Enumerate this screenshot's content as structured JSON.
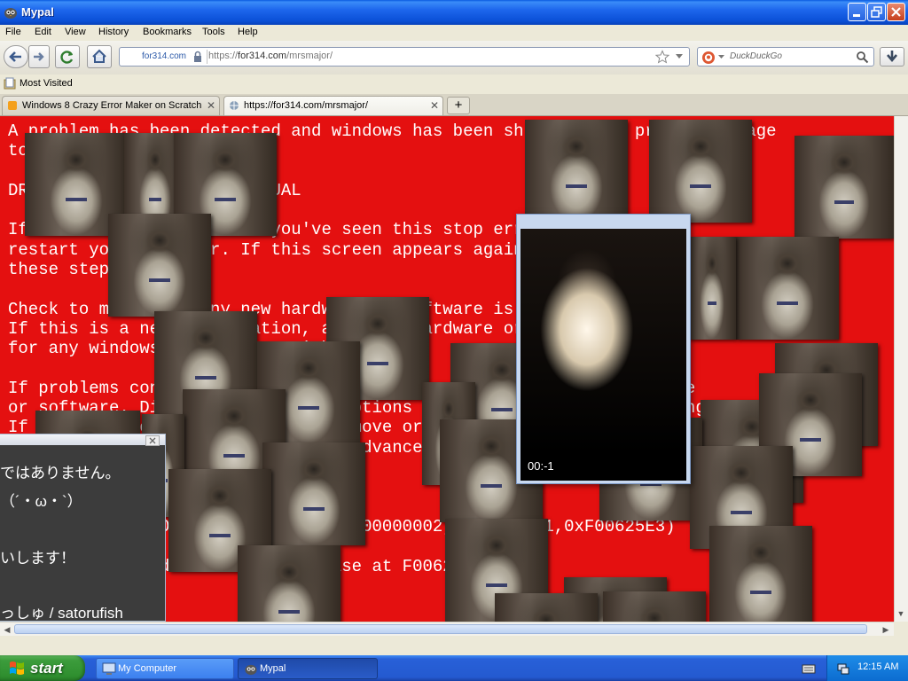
{
  "window": {
    "title": "Mypal"
  },
  "menu": [
    "File",
    "Edit",
    "View",
    "History",
    "Bookmarks",
    "Tools",
    "Help"
  ],
  "nav": {
    "identity": "for314.com",
    "url_prefix": "https://",
    "url_host": "for314.com",
    "url_path": "/mrsmajor/",
    "search_placeholder": "DuckDuckGo"
  },
  "bookmarks": {
    "most_visited": "Most Visited"
  },
  "tabs": [
    {
      "label": "Windows 8 Crazy Error Maker on Scratch"
    },
    {
      "label": "https://for314.com/mrsmajor/"
    }
  ],
  "bsod_lines": [
    "A problem has been detected and windows has been shut down to prevent damage",
    "to your computer.",
    "",
    "DRIVER_IRQL_NOT_LESS_OR_EQUAL",
    "",
    "If this is the first time you've seen this stop error screen,",
    "restart your computer. If this screen appears again, follow",
    "these steps:",
    "",
    "Check to make sure any new hardware or software is properly installed.",
    "If this is a new installation, ask your hardware or software manufacturer",
    "for any windows updates you might need.",
    "",
    "If problems continue, disable or remove any newly installed hardware",
    "or software. Disable BIOS memory options such as caching or shadowing.",
    "If you need to use Safe Mode to remove or disable components, restart",
    "your computer, press F8 to select Advanced Startup Options.",
    "",
    "",
    "",
    "*** STOP: 0x000000D1 (0x00000000,0x00000002,0x00000001,0xF00625E3)",
    "",
    "*** gv3.sys - Address F00625E3 base at F0062000"
  ],
  "video": {
    "time": "00:-1"
  },
  "jp_window": {
    "lines": [
      "ではありません。",
      "（´・ω・`）",
      "",
      "いします！",
      "",
      "っしゅ / satorufish"
    ]
  },
  "taskbar": {
    "start": "start",
    "tasks": [
      {
        "label": "My Computer"
      },
      {
        "label": "Mypal"
      }
    ],
    "clock": "12:15 AM"
  },
  "icons": {
    "window": "mypal-icon",
    "back": "back-arrow-icon",
    "forward": "forward-arrow-icon",
    "reload": "reload-icon",
    "home": "home-icon",
    "lock": "lock-icon",
    "star": "star-icon",
    "search": "magnifier-icon",
    "download": "download-arrow-icon"
  },
  "colors": {
    "bsod_background": "#e41010",
    "bsod_text": "#ffffff",
    "xp_blue": "#245ad0",
    "start_green": "#3c9c3c"
  }
}
